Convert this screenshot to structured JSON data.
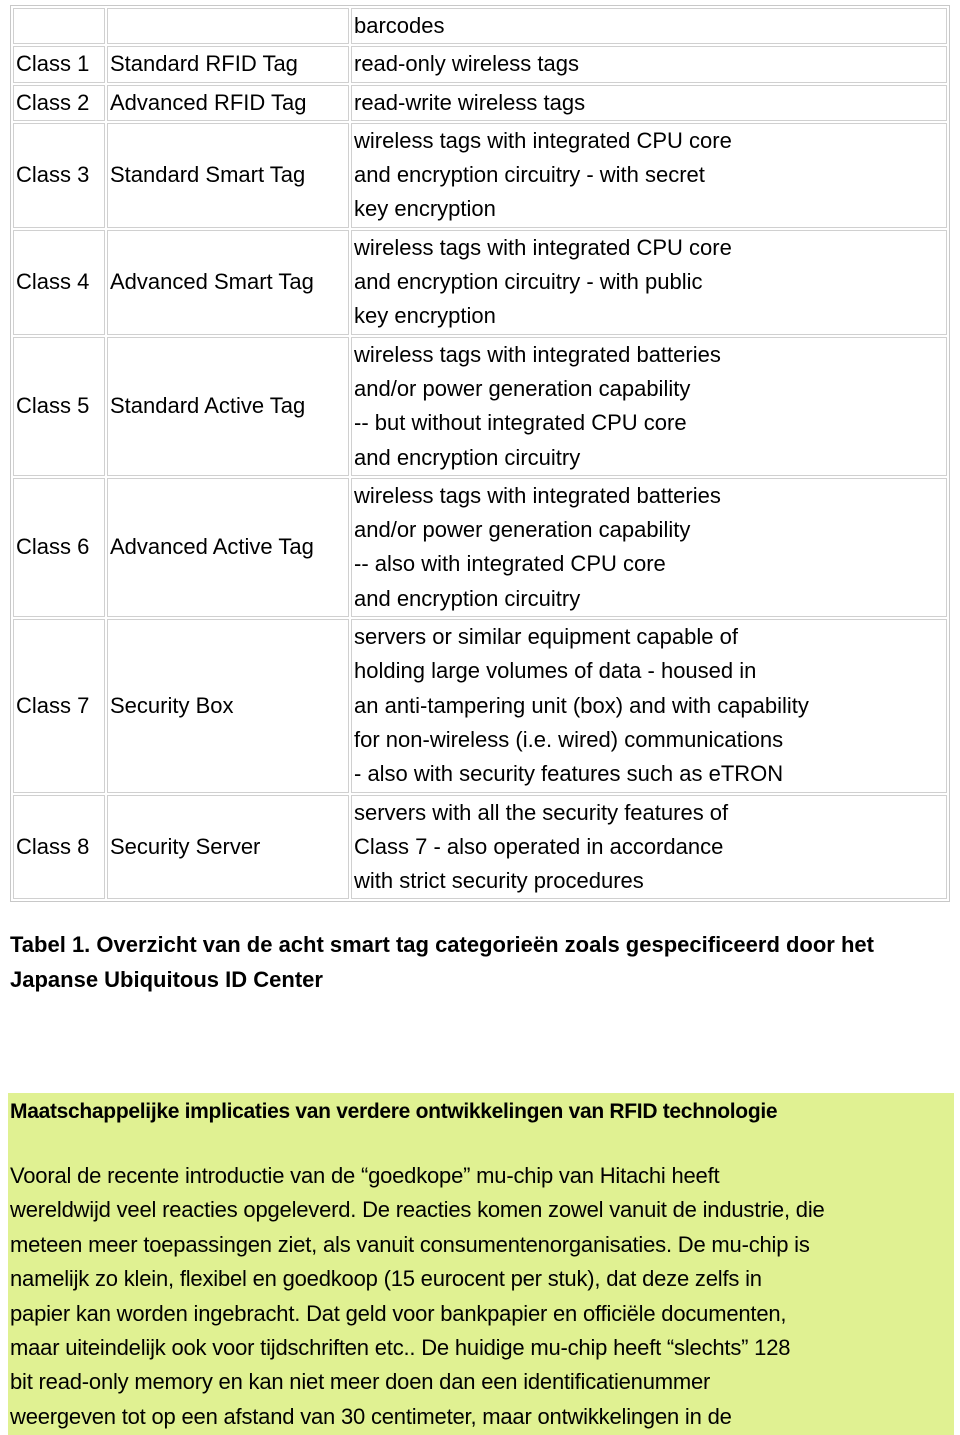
{
  "table": {
    "rows": [
      {
        "cls": "",
        "name": "",
        "desc": [
          "barcodes"
        ]
      },
      {
        "cls": "Class 1",
        "name": "Standard RFID Tag",
        "desc": [
          "read-only wireless tags"
        ]
      },
      {
        "cls": "Class 2",
        "name": "Advanced RFID Tag",
        "desc": [
          "read-write wireless tags"
        ]
      },
      {
        "cls": "Class 3",
        "name": "Standard Smart Tag",
        "desc": [
          "wireless tags with integrated CPU core",
          "and encryption circuitry - with secret",
          "key encryption"
        ]
      },
      {
        "cls": "Class 4",
        "name": "Advanced Smart Tag",
        "desc": [
          "wireless tags with integrated CPU core",
          "and encryption circuitry - with public",
          "key encryption"
        ]
      },
      {
        "cls": "Class 5",
        "name": "Standard Active Tag",
        "desc": [
          "wireless tags with integrated batteries",
          "and/or power generation capability",
          "-- but without integrated CPU core",
          "and encryption circuitry"
        ]
      },
      {
        "cls": "Class 6",
        "name": "Advanced Active Tag",
        "desc": [
          "wireless tags with integrated batteries",
          "and/or power generation capability",
          "-- also with integrated CPU core",
          "and encryption circuitry"
        ]
      },
      {
        "cls": "Class 7",
        "name": "Security Box",
        "desc": [
          "servers or similar equipment capable of",
          "holding large volumes of data - housed in",
          "an anti-tampering unit (box) and with capability",
          "for non-wireless (i.e. wired) communications",
          "- also with security features such as eTRON"
        ]
      },
      {
        "cls": "Class 8",
        "name": "Security Server",
        "desc": [
          "servers with all the security features of",
          "Class 7 - also operated in accordance",
          "with strict security procedures"
        ]
      }
    ]
  },
  "caption": [
    "Tabel  1. Overzicht van de acht smart tag categorieën zoals gespecificeerd door het",
    "Japanse Ubiquitous ID Center"
  ],
  "box": {
    "background": "#e0f192",
    "heading": "Maatschappelijke implicaties van verdere ontwikkelingen van RFID technologie",
    "lines": [
      "Vooral de recente introductie van de “goedkope” mu-chip van Hitachi heeft",
      "wereldwijd veel reacties opgeleverd. De reacties komen zowel vanuit de industrie, die",
      "meteen meer toepassingen ziet, als vanuit consumentenorganisaties. De mu-chip is",
      "namelijk zo klein, flexibel en goedkoop (15 eurocent per stuk), dat  deze zelfs in",
      "papier kan worden ingebracht. Dat geld voor bankpapier en officiële documenten,",
      "maar uiteindelijk ook voor tijdschriften etc.. De huidige mu-chip heeft “slechts” 128",
      "bit read-only memory en kan niet meer doen dan een identificatienummer",
      "weergeven  tot op een afstand van 30 centimeter, maar ontwikkelingen in de"
    ]
  }
}
